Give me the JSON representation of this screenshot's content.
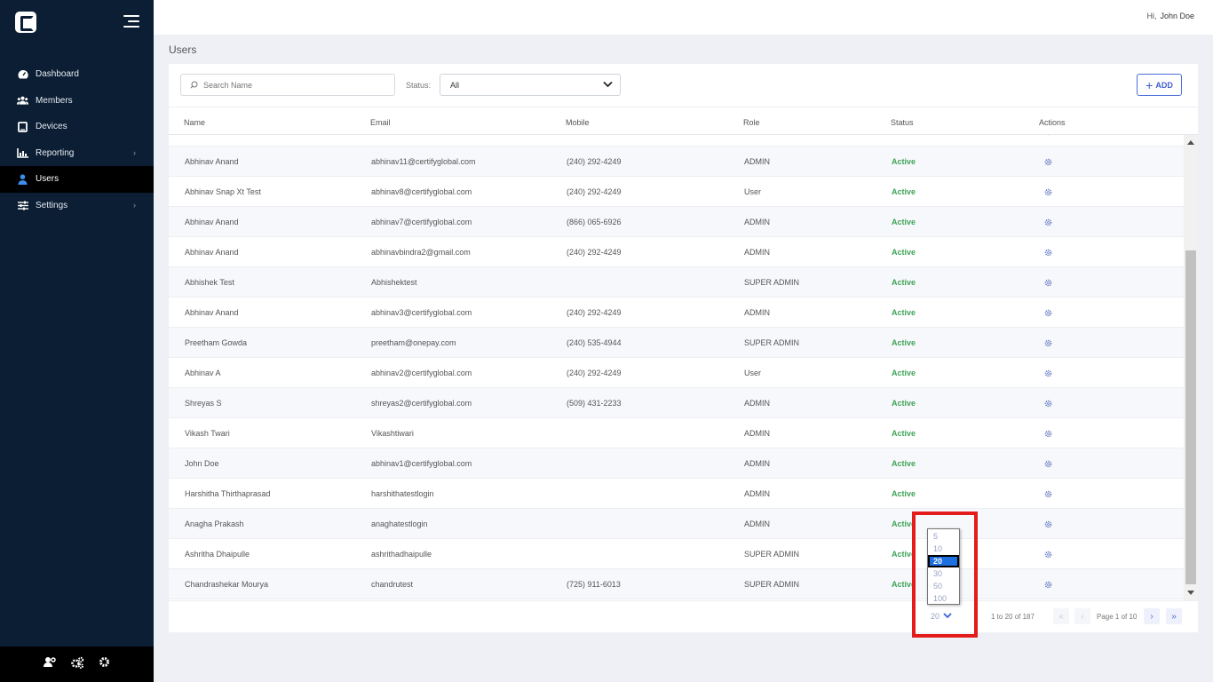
{
  "topbar": {
    "greeting_prefix": "Hi,",
    "user_name": "John Doe"
  },
  "sidebar": {
    "items": [
      {
        "label": "Dashboard",
        "icon": "dashboard-icon"
      },
      {
        "label": "Members",
        "icon": "members-icon"
      },
      {
        "label": "Devices",
        "icon": "devices-icon"
      },
      {
        "label": "Reporting",
        "icon": "reporting-icon",
        "has_submenu": true
      },
      {
        "label": "Users",
        "icon": "user-icon",
        "active": true
      },
      {
        "label": "Settings",
        "icon": "settings-sliders-icon",
        "has_submenu": true
      }
    ],
    "footer_icons": [
      "user-settings-icon",
      "cogs-icon",
      "gear-icon"
    ]
  },
  "page": {
    "title": "Users"
  },
  "toolbar": {
    "search_placeholder": "Search Name",
    "status_label": "Status:",
    "status_value": "All",
    "add_label": "ADD"
  },
  "table": {
    "columns": [
      "Name",
      "Email",
      "Mobile",
      "Role",
      "Status",
      "Actions"
    ],
    "rows": [
      {
        "name": "Abhinav Anand",
        "email": "abhinav11@certifyglobal.com",
        "mobile": "(240) 292-4249",
        "role": "ADMIN",
        "status": "Active"
      },
      {
        "name": "Abhinav Snap Xt Test",
        "email": "abhinav8@certifyglobal.com",
        "mobile": "(240) 292-4249",
        "role": "User",
        "status": "Active"
      },
      {
        "name": "Abhinav Anand",
        "email": "abhinav7@certifyglobal.com",
        "mobile": "(866) 065-6926",
        "role": "ADMIN",
        "status": "Active"
      },
      {
        "name": "Abhinav Anand",
        "email": "abhinavbindra2@gmail.com",
        "mobile": "(240) 292-4249",
        "role": "ADMIN",
        "status": "Active"
      },
      {
        "name": "Abhishek Test",
        "email": "Abhishektest",
        "mobile": "",
        "role": "SUPER ADMIN",
        "status": "Active"
      },
      {
        "name": "Abhinav Anand",
        "email": "abhinav3@certifyglobal.com",
        "mobile": "(240) 292-4249",
        "role": "ADMIN",
        "status": "Active"
      },
      {
        "name": "Preetham Gowda",
        "email": "preetham@onepay.com",
        "mobile": "(240) 535-4944",
        "role": "SUPER ADMIN",
        "status": "Active"
      },
      {
        "name": "Abhinav A",
        "email": "abhinav2@certifyglobal.com",
        "mobile": "(240) 292-4249",
        "role": "User",
        "status": "Active"
      },
      {
        "name": "Shreyas S",
        "email": "shreyas2@certifyglobal.com",
        "mobile": "(509) 431-2233",
        "role": "ADMIN",
        "status": "Active"
      },
      {
        "name": "Vikash Twari",
        "email": "Vikashtiwari",
        "mobile": "",
        "role": "ADMIN",
        "status": "Active"
      },
      {
        "name": "John Doe",
        "email": "abhinav1@certifyglobal.com",
        "mobile": "",
        "role": "ADMIN",
        "status": "Active"
      },
      {
        "name": "Harshitha Thirthaprasad",
        "email": "harshithatestlogin",
        "mobile": "",
        "role": "ADMIN",
        "status": "Active"
      },
      {
        "name": "Anagha Prakash",
        "email": "anaghatestlogin",
        "mobile": "",
        "role": "ADMIN",
        "status": "Active"
      },
      {
        "name": "Ashritha Dhaipulle",
        "email": "ashrithadhaipulle",
        "mobile": "",
        "role": "SUPER ADMIN",
        "status": "Active"
      },
      {
        "name": "Chandrashekar Mourya",
        "email": "chandrutest",
        "mobile": "(725) 911-6013",
        "role": "SUPER ADMIN",
        "status": "Active"
      }
    ]
  },
  "pagination": {
    "page_size": "20",
    "page_size_options": [
      "5",
      "10",
      "20",
      "30",
      "50",
      "100"
    ],
    "selected_option": "20",
    "range_text": "1 to 20 of 187",
    "page_text": "Page 1 of 10"
  },
  "colors": {
    "sidebar_bg": "#0b1e33",
    "accent": "#4a6fdc",
    "status_active": "#3ea356",
    "highlight_box": "#e41b1b"
  }
}
